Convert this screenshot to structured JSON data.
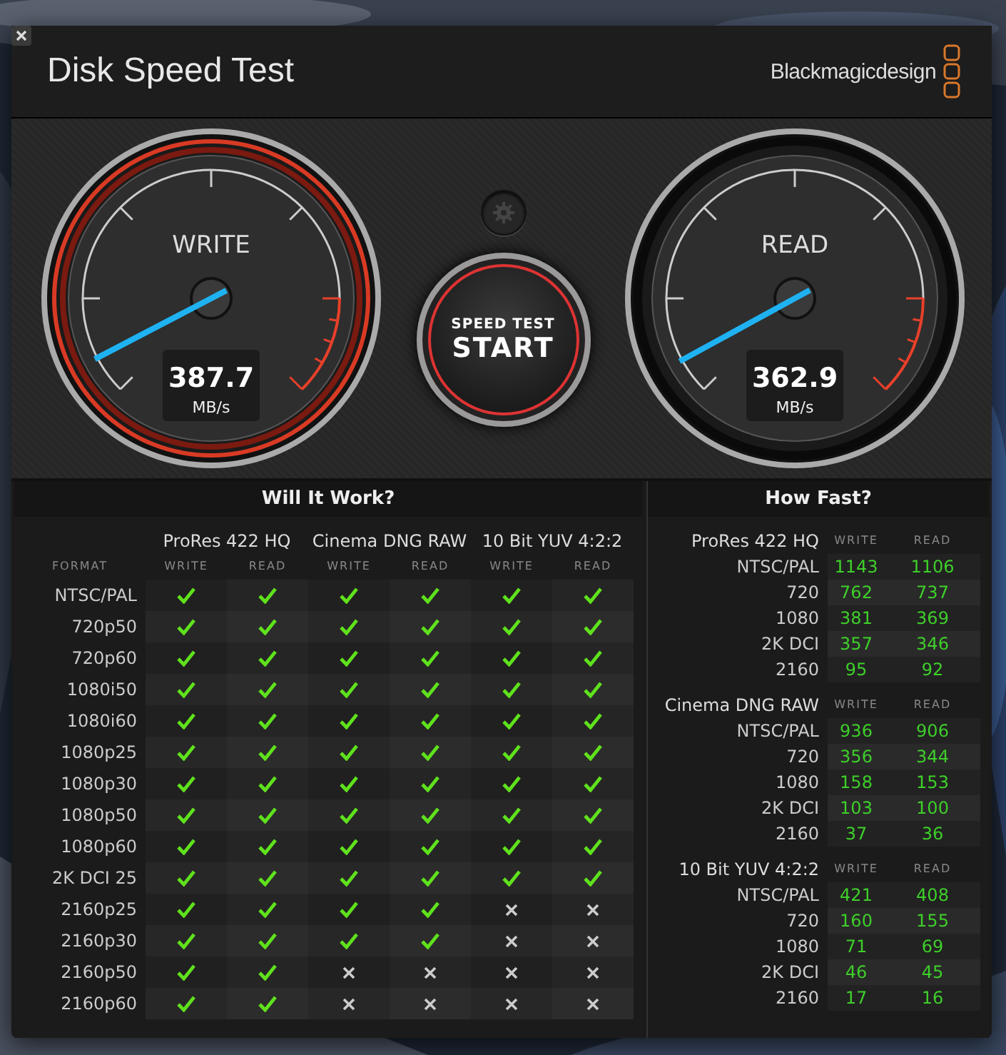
{
  "window": {
    "title": "Disk Speed Test",
    "brand": "Blackmagicdesign"
  },
  "gauges": [
    {
      "label": "WRITE",
      "value": "387.7",
      "unit": "MB/s",
      "active": true
    },
    {
      "label": "READ",
      "value": "362.9",
      "unit": "MB/s",
      "active": false
    }
  ],
  "start_button": {
    "caption": "SPEED TEST",
    "label": "START"
  },
  "will_it_work": {
    "title": "Will It Work?",
    "format_header": "FORMAT",
    "codecs": [
      {
        "name": "ProRes 422 HQ",
        "columns": [
          "WRITE",
          "READ"
        ]
      },
      {
        "name": "Cinema DNG RAW",
        "columns": [
          "WRITE",
          "READ"
        ]
      },
      {
        "name": "10 Bit YUV 4:2:2",
        "columns": [
          "WRITE",
          "READ"
        ]
      }
    ],
    "rows": [
      {
        "format": "NTSC/PAL",
        "results": [
          true,
          true,
          true,
          true,
          true,
          true
        ]
      },
      {
        "format": "720p50",
        "results": [
          true,
          true,
          true,
          true,
          true,
          true
        ]
      },
      {
        "format": "720p60",
        "results": [
          true,
          true,
          true,
          true,
          true,
          true
        ]
      },
      {
        "format": "1080i50",
        "results": [
          true,
          true,
          true,
          true,
          true,
          true
        ]
      },
      {
        "format": "1080i60",
        "results": [
          true,
          true,
          true,
          true,
          true,
          true
        ]
      },
      {
        "format": "1080p25",
        "results": [
          true,
          true,
          true,
          true,
          true,
          true
        ]
      },
      {
        "format": "1080p30",
        "results": [
          true,
          true,
          true,
          true,
          true,
          true
        ]
      },
      {
        "format": "1080p50",
        "results": [
          true,
          true,
          true,
          true,
          true,
          true
        ]
      },
      {
        "format": "1080p60",
        "results": [
          true,
          true,
          true,
          true,
          true,
          true
        ]
      },
      {
        "format": "2K DCI 25",
        "results": [
          true,
          true,
          true,
          true,
          true,
          true
        ]
      },
      {
        "format": "2160p25",
        "results": [
          true,
          true,
          true,
          true,
          false,
          false
        ]
      },
      {
        "format": "2160p30",
        "results": [
          true,
          true,
          true,
          true,
          false,
          false
        ]
      },
      {
        "format": "2160p50",
        "results": [
          true,
          true,
          false,
          false,
          false,
          false
        ]
      },
      {
        "format": "2160p60",
        "results": [
          true,
          true,
          false,
          false,
          false,
          false
        ]
      }
    ]
  },
  "how_fast": {
    "title": "How Fast?",
    "groups": [
      {
        "codec": "ProRes 422 HQ",
        "columns": [
          "WRITE",
          "READ"
        ],
        "rows": [
          {
            "format": "NTSC/PAL",
            "write": "1143",
            "read": "1106"
          },
          {
            "format": "720",
            "write": "762",
            "read": "737"
          },
          {
            "format": "1080",
            "write": "381",
            "read": "369"
          },
          {
            "format": "2K DCI",
            "write": "357",
            "read": "346"
          },
          {
            "format": "2160",
            "write": "95",
            "read": "92"
          }
        ]
      },
      {
        "codec": "Cinema DNG RAW",
        "columns": [
          "WRITE",
          "READ"
        ],
        "rows": [
          {
            "format": "NTSC/PAL",
            "write": "936",
            "read": "906"
          },
          {
            "format": "720",
            "write": "356",
            "read": "344"
          },
          {
            "format": "1080",
            "write": "158",
            "read": "153"
          },
          {
            "format": "2K DCI",
            "write": "103",
            "read": "100"
          },
          {
            "format": "2160",
            "write": "37",
            "read": "36"
          }
        ]
      },
      {
        "codec": "10 Bit YUV 4:2:2",
        "columns": [
          "WRITE",
          "READ"
        ],
        "rows": [
          {
            "format": "NTSC/PAL",
            "write": "421",
            "read": "408"
          },
          {
            "format": "720",
            "write": "160",
            "read": "155"
          },
          {
            "format": "1080",
            "write": "71",
            "read": "69"
          },
          {
            "format": "2K DCI",
            "write": "46",
            "read": "45"
          },
          {
            "format": "2160",
            "write": "17",
            "read": "16"
          }
        ]
      }
    ]
  }
}
